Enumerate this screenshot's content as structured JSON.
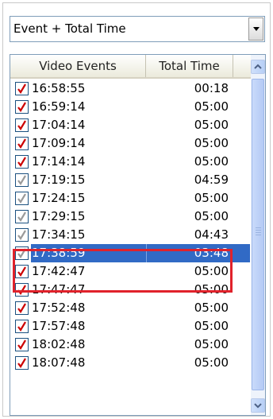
{
  "dropdown": {
    "selected": "Event + Total Time"
  },
  "table": {
    "headers": [
      "Video Events",
      "Total Time"
    ],
    "rows": [
      {
        "time": "16:58:55",
        "total": "00:18",
        "checked": true,
        "check_color": "#cc0000"
      },
      {
        "time": "16:59:14",
        "total": "05:00",
        "checked": true,
        "check_color": "#cc0000"
      },
      {
        "time": "17:04:14",
        "total": "05:00",
        "checked": true,
        "check_color": "#cc0000"
      },
      {
        "time": "17:09:14",
        "total": "05:00",
        "checked": true,
        "check_color": "#cc0000"
      },
      {
        "time": "17:14:14",
        "total": "05:00",
        "checked": true,
        "check_color": "#cc0000"
      },
      {
        "time": "17:19:15",
        "total": "04:59",
        "checked": true,
        "check_color": "#9a9a9a"
      },
      {
        "time": "17:24:15",
        "total": "05:00",
        "checked": true,
        "check_color": "#9a9a9a"
      },
      {
        "time": "17:29:15",
        "total": "05:00",
        "checked": true,
        "check_color": "#9a9a9a"
      },
      {
        "time": "17:34:15",
        "total": "04:43",
        "checked": true,
        "check_color": "#9a9a9a"
      },
      {
        "time": "17:38:59",
        "total": "03:48",
        "checked": true,
        "check_color": "#9a9a9a",
        "selected": true
      },
      {
        "time": "17:42:47",
        "total": "05:00",
        "checked": true,
        "check_color": "#cc0000"
      },
      {
        "time": "17:47:47",
        "total": "05:00",
        "checked": true,
        "check_color": "#cc0000"
      },
      {
        "time": "17:52:48",
        "total": "05:00",
        "checked": true,
        "check_color": "#cc0000"
      },
      {
        "time": "17:57:48",
        "total": "05:00",
        "checked": true,
        "check_color": "#cc0000"
      },
      {
        "time": "18:02:48",
        "total": "05:00",
        "checked": true,
        "check_color": "#cc0000"
      },
      {
        "time": "18:07:48",
        "total": "05:00",
        "checked": true,
        "check_color": "#cc0000"
      }
    ]
  },
  "icons": {
    "dropdown": "chevron-down-icon",
    "scroll_up": "scroll-up-arrow-icon",
    "scroll_down": "scroll-down-arrow-icon",
    "check": "checkmark-icon"
  },
  "colors": {
    "selection": "#316ac5",
    "highlight_box": "#e0222b",
    "check_active": "#cc0000",
    "check_inactive": "#9a9a9a"
  }
}
